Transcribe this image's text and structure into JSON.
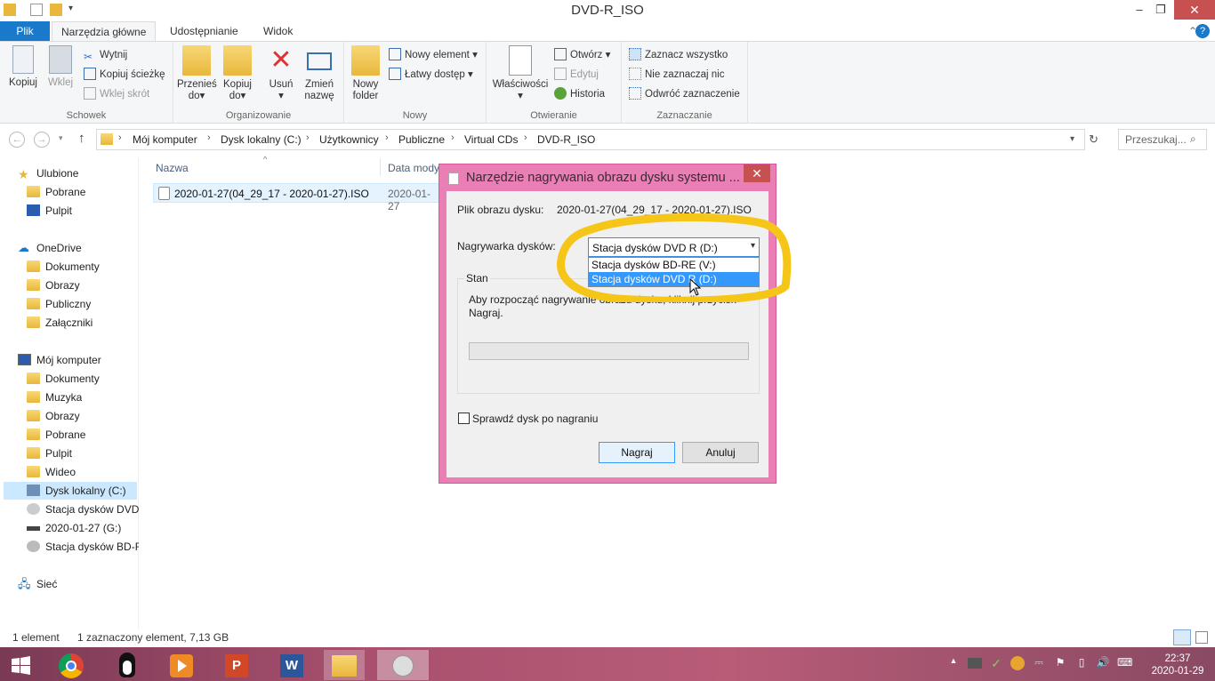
{
  "window": {
    "title": "DVD-R_ISO"
  },
  "ribbon_tabs": [
    "Plik",
    "Narzędzia główne",
    "Udostępnianie",
    "Widok"
  ],
  "ribbon": {
    "schowek": {
      "label": "Schowek",
      "kopiuj": "Kopiuj",
      "wklej": "Wklej",
      "wytnij": "Wytnij",
      "kopiuj_sciezke": "Kopiuj ścieżkę",
      "wklej_skrot": "Wklej skrót"
    },
    "organizowanie": {
      "label": "Organizowanie",
      "przenies": "Przenieś",
      "kopiuj_do": "Kopiuj",
      "do": "do",
      "usun": "Usuń",
      "zmien": "Zmień",
      "nazwe": "nazwę"
    },
    "nowy": {
      "label": "Nowy",
      "nowy": "Nowy",
      "folder": "folder",
      "nowy_element": "Nowy element",
      "latwy_dostep": "Łatwy dostęp"
    },
    "otwieranie": {
      "label": "Otwieranie",
      "wlasciwosci": "Właściwości",
      "otworz": "Otwórz",
      "edytuj": "Edytuj",
      "historia": "Historia"
    },
    "zaznaczanie": {
      "label": "Zaznaczanie",
      "zaznacz_wszystko": "Zaznacz wszystko",
      "nie_zaznaczaj": "Nie zaznaczaj nic",
      "odwroc": "Odwróć zaznaczenie"
    }
  },
  "breadcrumb": [
    "Mój komputer",
    "Dysk lokalny (C:)",
    "Użytkownicy",
    "Publiczne",
    "Virtual CDs",
    "DVD-R_ISO"
  ],
  "search": {
    "placeholder": "Przeszukaj..."
  },
  "nav": {
    "favorites": [
      "Ulubione",
      "Pobrane",
      "Pulpit"
    ],
    "onedrive": [
      "OneDrive",
      "Dokumenty",
      "Obrazy",
      "Publiczny",
      "Załączniki"
    ],
    "computer": [
      "Mój komputer",
      "Dokumenty",
      "Muzyka",
      "Obrazy",
      "Pobrane",
      "Pulpit",
      "Wideo",
      "Dysk lokalny (C:)",
      "Stacja dysków DVD",
      "2020-01-27 (G:)",
      "Stacja dysków BD-R"
    ],
    "network": "Sieć"
  },
  "columns": {
    "name": "Nazwa",
    "date": "Data mody"
  },
  "file": {
    "name": "2020-01-27(04_29_17 - 2020-01-27).ISO",
    "date": "2020-01-27"
  },
  "status": {
    "count": "1 element",
    "selected": "1 zaznaczony element, 7,13 GB"
  },
  "dialog": {
    "title": "Narzędzie nagrywania obrazu dysku systemu ...",
    "image_label": "Plik obrazu dysku:",
    "image_value": "2020-01-27(04_29_17 - 2020-01-27).ISO",
    "burner_label": "Nagrywarka dysków:",
    "burner_selected": "Stacja dysków DVD R (D:)",
    "options": [
      "Stacja dysków BD-RE (V:)",
      "Stacja dysków DVD R (D:)"
    ],
    "state_label": "Stan",
    "state_text_1": "Aby rozpocząć nagrywanie obrazu dysku, kliknij przycisk",
    "state_text_2": "Nagraj.",
    "verify_label": "Sprawdź dysk po nagraniu",
    "burn_button": "Nagraj",
    "cancel_button": "Anuluj"
  },
  "clock": {
    "time": "22:37",
    "date": "2020-01-29"
  },
  "colors": {
    "accent": "#1979ca",
    "dialog_frame": "#e97fb5",
    "highlight": "#3399ff",
    "annotation": "#f5c518"
  }
}
